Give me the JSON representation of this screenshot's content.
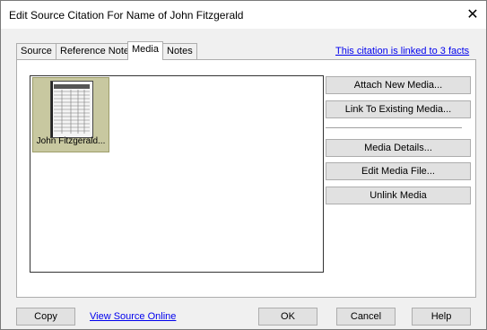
{
  "window": {
    "title": "Edit Source Citation For Name of John Fitzgerald",
    "close_glyph": "✕"
  },
  "tabs": [
    {
      "label": "Source",
      "active": false
    },
    {
      "label": "Reference Note",
      "active": false
    },
    {
      "label": "Media",
      "active": true
    },
    {
      "label": "Notes",
      "active": false
    }
  ],
  "facts_link": "This citation is linked to 3 facts",
  "media_items": [
    {
      "caption": "John Fitzgerald..."
    }
  ],
  "media_buttons": {
    "attach": "Attach New Media...",
    "link_existing": "Link To Existing Media...",
    "details": "Media Details...",
    "edit_file": "Edit Media File...",
    "unlink": "Unlink Media"
  },
  "footer": {
    "copy": "Copy",
    "view_online": "View Source Online",
    "ok": "OK",
    "cancel": "Cancel",
    "help": "Help"
  },
  "colors": {
    "link": "#0000ee",
    "thumb_highlight": "#c8c8a0",
    "dialog_bg": "#f0f0f0"
  }
}
